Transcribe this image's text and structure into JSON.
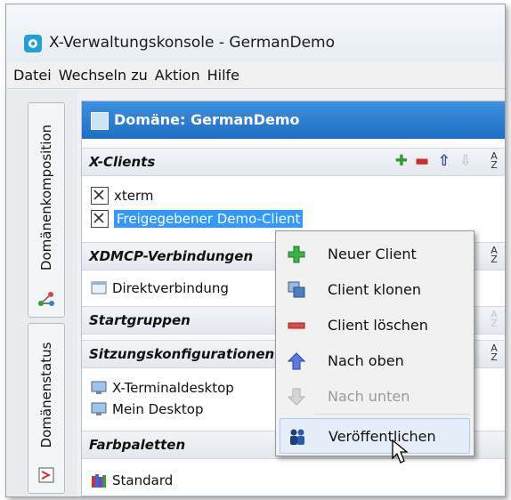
{
  "window": {
    "title": "X-Verwaltungskonsole - GermanDemo",
    "icon": "gear-app-icon"
  },
  "menu": [
    "Datei",
    "Wechseln zu",
    "Aktion",
    "Hilfe"
  ],
  "vertical_tabs": [
    {
      "label": "Domänenkomposition",
      "icon": "network-icon"
    },
    {
      "label": "Domänenstatus",
      "icon": "status-chart-icon"
    }
  ],
  "panel": {
    "header": "Domäne: GermanDemo",
    "sections": {
      "xclients": {
        "title": "X-Clients",
        "items": [
          "xterm",
          "Freigegebener Demo-Client"
        ],
        "selected": "Freigegebener Demo-Client"
      },
      "xdmcp": {
        "title": "XDMCP-Verbindungen",
        "items": [
          "Direktverbindung"
        ]
      },
      "startgruppen": {
        "title": "Startgruppen"
      },
      "sitzung": {
        "title": "Sitzungskonfigurationen",
        "items": [
          "X-Terminaldesktop",
          "Mein Desktop"
        ]
      },
      "farb": {
        "title": "Farbpaletten",
        "items": [
          "Standard"
        ]
      }
    },
    "sort_label_top": "A",
    "sort_label_bottom": "Z"
  },
  "context_menu": {
    "items": [
      {
        "label": "Neuer Client",
        "icon": "green-plus-icon",
        "enabled": true
      },
      {
        "label": "Client klonen",
        "icon": "clone-icon",
        "enabled": true
      },
      {
        "label": "Client löschen",
        "icon": "red-minus-icon",
        "enabled": true
      },
      {
        "label": "Nach oben",
        "icon": "arrow-up-icon",
        "enabled": true
      },
      {
        "label": "Nach unten",
        "icon": "arrow-down-icon",
        "enabled": false
      },
      {
        "label": "Veröffentlichen",
        "icon": "people-icon",
        "enabled": true,
        "highlighted": true
      }
    ]
  },
  "colors": {
    "header_blue": "#1d6fc4",
    "selection": "#3399ff",
    "app_icon": "#23a0d8"
  }
}
